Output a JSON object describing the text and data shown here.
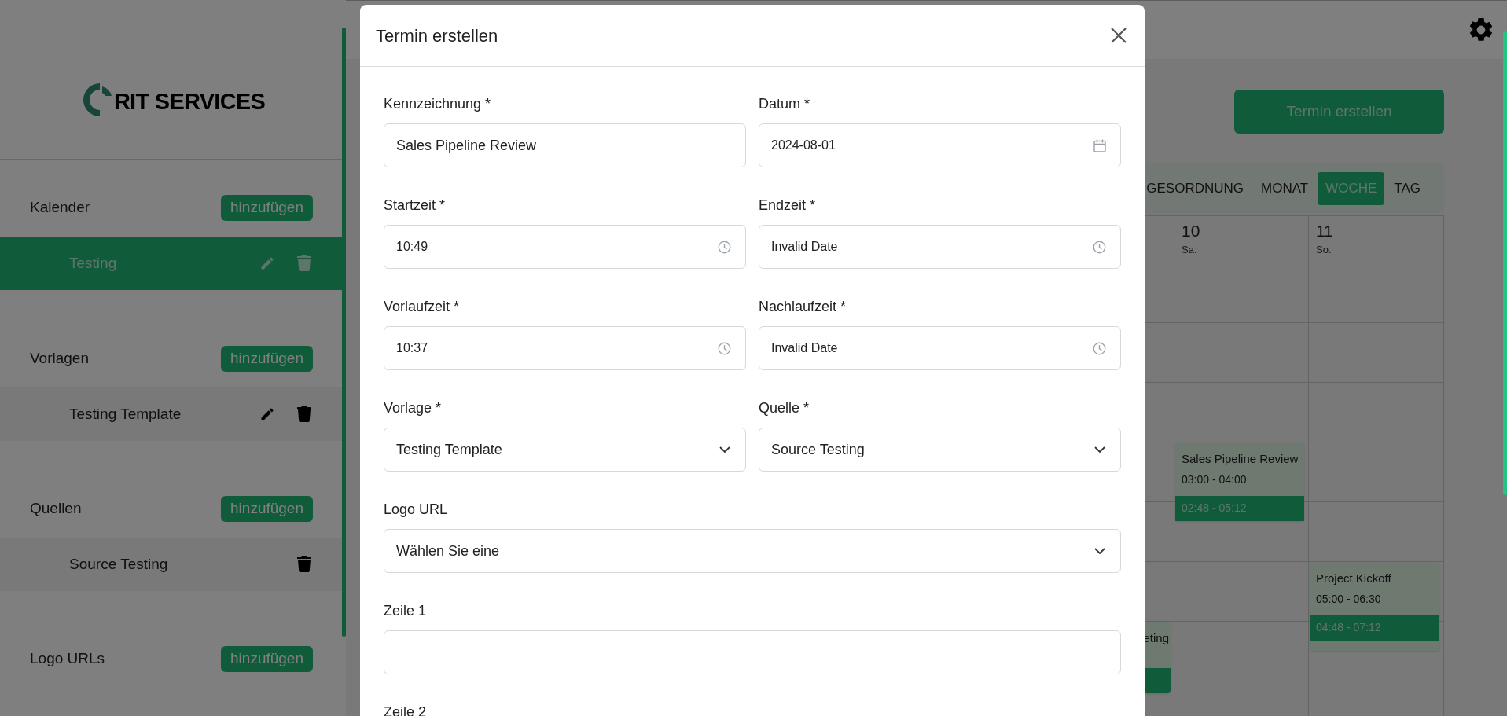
{
  "logo": {
    "text": "RIT SERVICES"
  },
  "sidebar": {
    "sections": [
      {
        "title": "Kalender",
        "add_button": "hinzufügen",
        "items": [
          {
            "label": "Testing",
            "selected": true,
            "editable": true
          }
        ]
      },
      {
        "title": "Vorlagen",
        "add_button": "hinzufügen",
        "items": [
          {
            "label": "Testing Template",
            "selected": false,
            "editable": true
          }
        ]
      },
      {
        "title": "Quellen",
        "add_button": "hinzufügen",
        "items": [
          {
            "label": "Source Testing",
            "selected": false,
            "editable": false
          }
        ]
      },
      {
        "title": "Logo URLs",
        "add_button": "hinzufügen"
      }
    ]
  },
  "calendar": {
    "create_button": "Termin erstellen",
    "views": [
      {
        "label": "GESORDNUNG",
        "selected": false
      },
      {
        "label": "MONAT",
        "selected": false
      },
      {
        "label": "WOCHE",
        "selected": true
      },
      {
        "label": "TAG",
        "selected": false
      }
    ],
    "days": [
      {
        "events": [
          {
            "title": "eting"
          }
        ]
      },
      {
        "number": "10",
        "weekday": "Sa.",
        "events": [
          {
            "title": "Sales Pipeline Review",
            "time": "03:00 - 04:00",
            "buffer": "02:48 - 05:12"
          }
        ]
      },
      {
        "number": "11",
        "weekday": "So.",
        "events": [
          {
            "title": "Project Kickoff",
            "time": "05:00 - 06:30",
            "buffer": "04:48 - 07:12"
          }
        ]
      }
    ]
  },
  "dialog": {
    "title": "Termin erstellen",
    "fields": [
      {
        "label": "Kennzeichnung *",
        "kind": "text",
        "value": "Sales Pipeline Review"
      },
      {
        "label": "Datum *",
        "kind": "date",
        "value": "2024-08-01"
      },
      {
        "label": "Startzeit *",
        "kind": "time",
        "value": "10:49"
      },
      {
        "label": "Endzeit *",
        "kind": "time",
        "value": "Invalid Date"
      },
      {
        "label": "Vorlaufzeit *",
        "kind": "time",
        "value": "10:37"
      },
      {
        "label": "Nachlaufzeit *",
        "kind": "time",
        "value": "Invalid Date"
      },
      {
        "label": "Vorlage *",
        "kind": "select",
        "value": "Testing Template"
      },
      {
        "label": "Quelle *",
        "kind": "select",
        "value": "Source Testing"
      },
      {
        "label": "Logo URL",
        "kind": "select",
        "value": "Wählen Sie eine",
        "full": true
      },
      {
        "label": "Zeile 1",
        "kind": "text",
        "full": true
      },
      {
        "label": "Zeile 2",
        "kind": "text",
        "full": true
      }
    ]
  }
}
